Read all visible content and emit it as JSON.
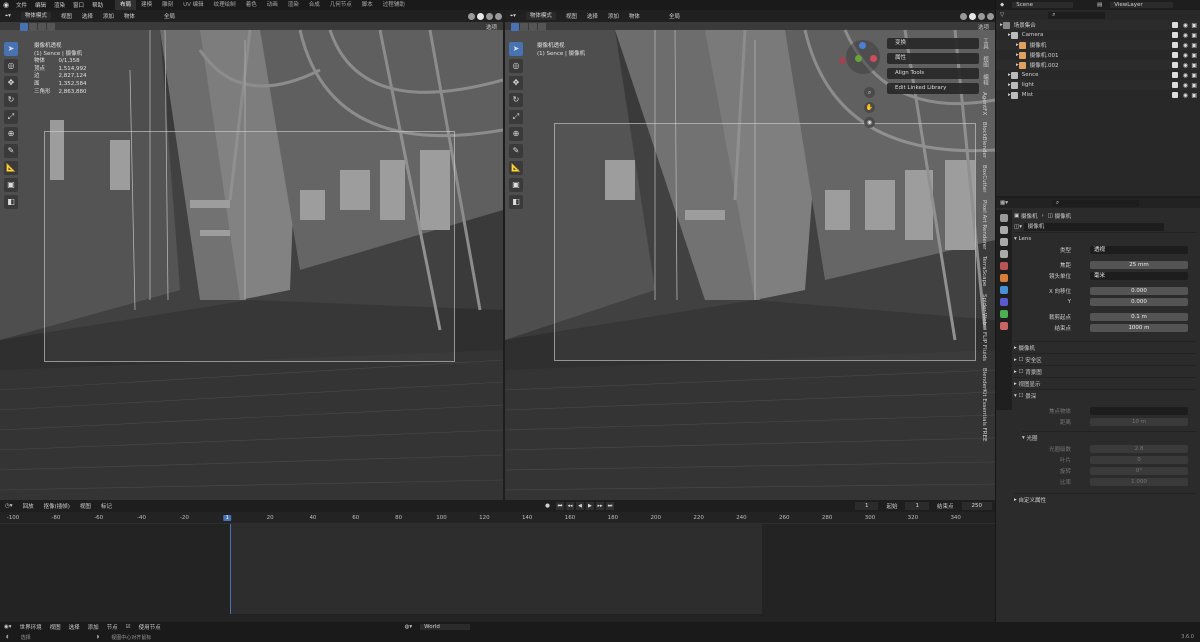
{
  "topbar": {
    "menus": [
      "文件",
      "编辑",
      "渲染",
      "窗口",
      "帮助"
    ],
    "workspaces": [
      "布局",
      "建模",
      "雕刻",
      "UV 编辑",
      "纹理绘制",
      "着色",
      "动画",
      "渲染",
      "合成",
      "几何节点",
      "脚本",
      "过程辅助"
    ]
  },
  "viewport_left": {
    "mode": "物体模式",
    "menu": [
      "视图",
      "选择",
      "添加",
      "物体"
    ],
    "transform": "全局",
    "options": "选项",
    "title": "摄像机透视",
    "subtitle": "(1) Sence | 摄像机",
    "stats": [
      [
        "物体",
        "0/1,358"
      ],
      [
        "顶点",
        "1,514,992"
      ],
      [
        "边",
        "2,827,124"
      ],
      [
        "面",
        "1,352,584"
      ],
      [
        "三角形",
        "2,863,880"
      ]
    ]
  },
  "viewport_right": {
    "mode": "物体模式",
    "menu": [
      "视图",
      "选择",
      "添加",
      "物体"
    ],
    "transform": "全局",
    "options": "选项",
    "title": "摄像机透视",
    "subtitle": "(1) Sence | 摄像机",
    "panels": [
      "变换",
      "属性",
      "Align Tools",
      "Edit Linked Library"
    ],
    "tabs": [
      "工具",
      "视图",
      "编辑",
      "AgentFX",
      "BlockBlender",
      "BoxCutter",
      "Pixel Art Renderer",
      "TerraScape",
      "Spider-Web",
      "FLIP Fluids",
      "BlenderKit Essentials FREE"
    ]
  },
  "timeline": {
    "menu": [
      "回放",
      "抠像(插帧)",
      "视图",
      "标记"
    ],
    "frame_current": "1",
    "start_label": "起始",
    "start": "1",
    "end_label": "结束点",
    "end": "250",
    "ticks": [
      "-100",
      "-80",
      "-60",
      "-40",
      "-20",
      "1",
      "20",
      "40",
      "60",
      "80",
      "100",
      "120",
      "140",
      "160",
      "180",
      "200",
      "220",
      "240",
      "260",
      "280",
      "300",
      "320",
      "340"
    ]
  },
  "statusbar": {
    "editor": "世界环境",
    "menu": [
      "视图",
      "选择",
      "添加",
      "节点"
    ],
    "use_nodes": "使用节点",
    "world": "World",
    "hint_select": "选择",
    "hint_center": "视图中心对齐鼠标",
    "version": "3.6.0"
  },
  "outliner": {
    "scene": "Scene",
    "view_layer": "ViewLayer",
    "rows": [
      {
        "name": "场景集合",
        "indent": 0,
        "color": "#888888"
      },
      {
        "name": "Camera",
        "indent": 1,
        "color": "#bbbbbb"
      },
      {
        "name": "摄像机",
        "indent": 2,
        "color": "#e0a060"
      },
      {
        "name": "摄像机.001",
        "indent": 2,
        "color": "#e0a060"
      },
      {
        "name": "摄像机.002",
        "indent": 2,
        "color": "#e0a060"
      },
      {
        "name": "Sence",
        "indent": 1,
        "color": "#bbbbbb"
      },
      {
        "name": "light",
        "indent": 1,
        "color": "#bbbbbb"
      },
      {
        "name": "Mist",
        "indent": 1,
        "color": "#bbbbbb"
      }
    ]
  },
  "properties": {
    "breadcrumb_a": "摄像机",
    "breadcrumb_b": "摄像机",
    "data_name": "摄像机",
    "lens_section": "Lens",
    "type_label": "类型",
    "type_value": "透视",
    "focal_label": "焦距",
    "focal_value": "25 mm",
    "unit_label": "镜头单位",
    "unit_value": "毫米",
    "shiftx_label": "X 向移位",
    "shiftx_value": "0.000",
    "shifty_label": "Y",
    "shifty_value": "0.000",
    "clipstart_label": "裁剪起点",
    "clipstart_value": "0.1 m",
    "clipend_label": "结束点",
    "clipend_value": "1000 m",
    "sections": [
      "摄像机",
      "安全区",
      "背景图",
      "视图显示"
    ],
    "dof_section": "景深",
    "focus_obj_label": "焦点物体",
    "focus_dist_label": "距离",
    "focus_dist_value": "10 m",
    "aperture_section": "光圈",
    "fstop_label": "光圈级数",
    "fstop_value": "2.8",
    "blades_label": "叶片",
    "blades_value": "0",
    "rotation_label": "旋转",
    "rotation_value": "0°",
    "ratio_label": "比率",
    "ratio_value": "1.000",
    "custom_section": "自定义属性"
  }
}
